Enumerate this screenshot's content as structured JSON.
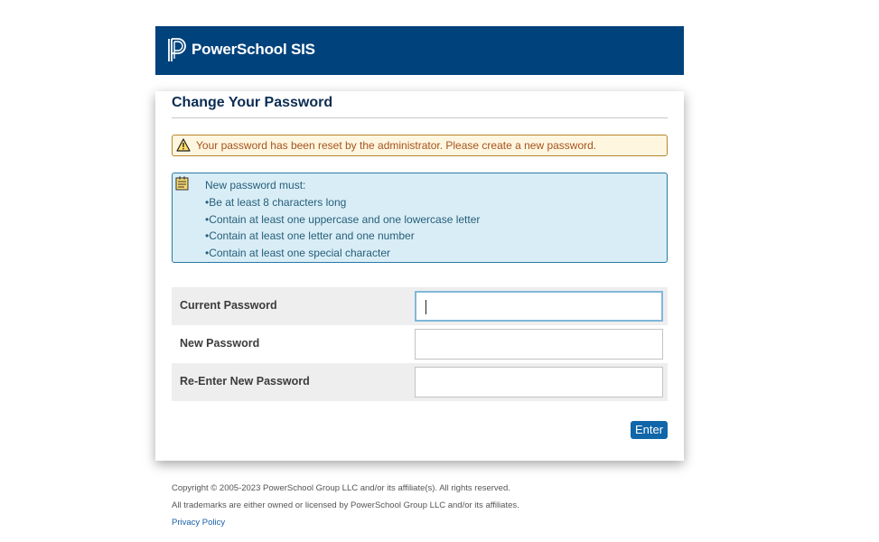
{
  "header": {
    "brand": "PowerSchool SIS",
    "logo_icon": "powerschool-p-logo",
    "bg_color": "#00427c"
  },
  "page": {
    "title": "Change Your Password"
  },
  "warning": {
    "icon": "warning-triangle-icon",
    "text": "Your password has been reset by the administrator. Please create a new password."
  },
  "info": {
    "icon": "notepad-icon",
    "lines": [
      "New password must:",
      "•Be at least 8 characters long",
      "•Contain at least one uppercase and one lowercase letter",
      "•Contain at least one letter and one number",
      "•Contain at least one special character"
    ]
  },
  "form": {
    "fields": [
      {
        "label": "Current Password",
        "value": ""
      },
      {
        "label": "New Password",
        "value": ""
      },
      {
        "label": "Re-Enter New Password",
        "value": ""
      }
    ],
    "submit_label": "Enter"
  },
  "footer": {
    "copyright": "Copyright © 2005-2023 PowerSchool Group LLC and/or its affiliate(s). All rights reserved.",
    "trademarks": "All trademarks are either owned or licensed by PowerSchool Group LLC and/or its affiliates.",
    "privacy_link": "Privacy Policy"
  }
}
